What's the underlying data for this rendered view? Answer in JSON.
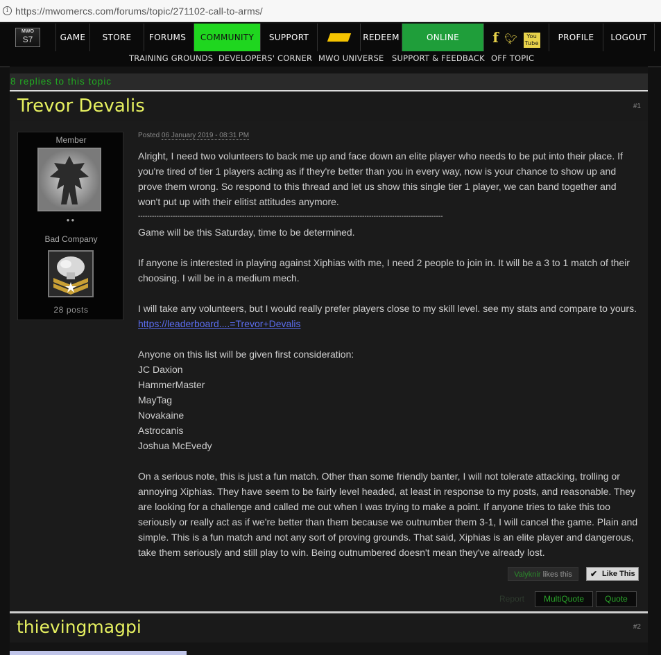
{
  "browser": {
    "url": "https://mwomercs.com/forums/topic/271102-call-to-arms/"
  },
  "nav": {
    "logo_top": "MWO",
    "logo_bottom": "S7",
    "items": [
      "GAME",
      "STORE",
      "FORUMS",
      "COMMUNITY",
      "SUPPORT",
      "REDEEM",
      "ONLINE",
      "PROFILE",
      "LOGOUT"
    ],
    "active_color": "#1fd61f",
    "online_color": "#1f9e3a"
  },
  "subnav": {
    "items": [
      "TRAINING GROUNDS",
      "DEVELOPERS' CORNER",
      "MWO UNIVERSE",
      "SUPPORT & FEEDBACK",
      "OFF TOPIC"
    ]
  },
  "topic": {
    "replies": "8 replies to this topic"
  },
  "post1": {
    "author": "Trevor Devalis",
    "number": "#1",
    "member_label": "Member",
    "unit": "Bad Company",
    "posts": "28 posts",
    "posted_prefix": "Posted",
    "posted_date": "06 January 2019 - 08:31 PM",
    "p1": "Alright, I need two volunteers to back me up and face down an elite player who needs to be put into their place. If you're tired of tier 1 players acting as if they're better than you in every way, now is your chance to show up and prove them wrong. So respond to this thread and let us show this single tier 1 player, we can band together and won't put up with their elitist attitudes anymore.",
    "dashes": "------------------------------------------------------------------------------------------------------------------------------------",
    "p2": "Game will be this Saturday, time to be determined.",
    "p3": "If anyone is interested in playing against Xiphias with me, I need 2 people to join in. It will be a 3 to 1 match of their choosing. I will be in a medium mech.",
    "p4": "I will take any volunteers, but I would really prefer players close to my skill level. see my stats and compare to yours.",
    "link": "https://leaderboard....=Trevor+Devalis",
    "p5": "Anyone on this list will be given first consideration:",
    "list": [
      "JC Daxion",
      "HammerMaster",
      "MayTag",
      "Novakaine",
      "Astrocanis",
      "Joshua McEvedy"
    ],
    "p6": "On a serious note, this is just a fun match. Other than some friendly banter, I will not tolerate attacking, trolling or annoying Xiphias. They have seem to be fairly level headed, at least in response to my posts, and reasonable. They are looking for a challenge and called me out when I was trying to make a point. If anyone tries to take this too seriously or really act as if we're better than them because we outnumber them 3-1, I will cancel the game. Plain and simple. This is a fun match and not any sort of proving grounds. That said, Xiphias is an elite player and dangerous, take them seriously and still play to win. Being outnumbered doesn't mean they've already lost.",
    "liker": "Valyknir",
    "likes_suffix": " likes this",
    "like_button": "Like This",
    "report": "Report",
    "multiquote": "MultiQuote",
    "quote": "Quote"
  },
  "post2": {
    "author": "thievingmagpi",
    "number": "#2"
  }
}
